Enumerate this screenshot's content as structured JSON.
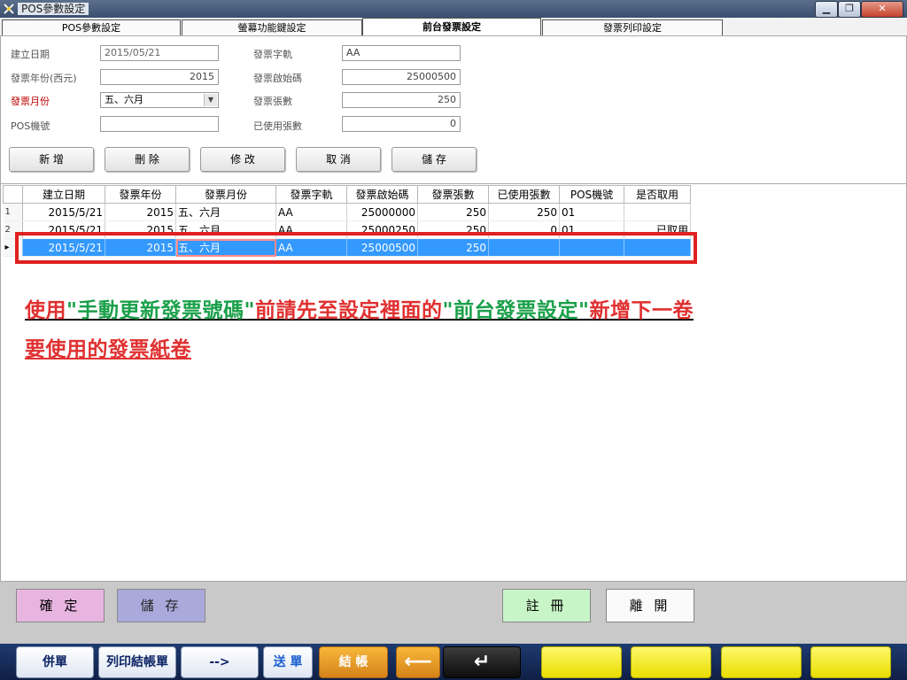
{
  "window": {
    "title": "POS參數設定",
    "controls": {
      "minimize": "▁",
      "restore": "❐",
      "close": "✕"
    }
  },
  "tabs": [
    {
      "label": "POS參數設定",
      "active": false
    },
    {
      "label": "螢幕功能鍵設定",
      "active": false
    },
    {
      "label": "前台發票設定",
      "active": true
    },
    {
      "label": "發票列印設定",
      "active": false
    }
  ],
  "form": {
    "created_date": {
      "label": "建立日期",
      "value": "2015/05/21"
    },
    "invoice_year": {
      "label": "發票年份(西元)",
      "value": "2015"
    },
    "invoice_month": {
      "label": "發票月份",
      "value": "五、六月"
    },
    "pos_number": {
      "label": "POS機號",
      "value": ""
    },
    "invoice_track": {
      "label": "發票字軌",
      "value": "AA"
    },
    "start_number": {
      "label": "發票啟始碼",
      "value": "25000500"
    },
    "invoice_count": {
      "label": "發票張數",
      "value": "250"
    },
    "used_count": {
      "label": "已使用張數",
      "value": "0"
    }
  },
  "actions": {
    "add": "新 增",
    "delete": "刪 除",
    "edit": "修 改",
    "cancel": "取 消",
    "save": "儲 存"
  },
  "grid": {
    "columns": [
      "建立日期",
      "發票年份",
      "發票月份",
      "發票字軌",
      "發票啟始碼",
      "發票張數",
      "已使用張數",
      "POS機號",
      "是否取用"
    ],
    "rows": [
      {
        "idx": "1",
        "date": "2015/5/21",
        "year": "2015",
        "month": "五、六月",
        "track": "AA",
        "start": "25000000",
        "count": "250",
        "used": "250",
        "pos": "01",
        "taken": ""
      },
      {
        "idx": "2",
        "date": "2015/5/21",
        "year": "2015",
        "month": "五、六月",
        "track": "AA",
        "start": "25000250",
        "count": "250",
        "used": "0",
        "pos": "01",
        "taken": "已取用"
      },
      {
        "idx": "▸",
        "date": "2015/5/21",
        "year": "2015",
        "month": "五、六月",
        "track": "AA",
        "start": "25000500",
        "count": "250",
        "used": "",
        "pos": "",
        "taken": ""
      }
    ]
  },
  "note": {
    "p1": "使用",
    "p2": "\"手動更新發票號碼\"",
    "p3": "前請先至設定裡面的",
    "p4": "\"前台發票設定\"",
    "p5": "新增下一卷",
    "line2": "要使用的發票紙卷"
  },
  "bottom": {
    "confirm": "確 定",
    "save": "儲 存",
    "register": "註 冊",
    "leave": "離 開"
  },
  "taskbar": {
    "merge": "併單",
    "print_checkout": "列印結帳單",
    "next": "-->",
    "send_order": "送 單",
    "checkout": "結 帳",
    "back_arrow": "⟵",
    "enter_arrow": "↵"
  },
  "colors": {
    "accent_selected_row": "#3399ff",
    "annotation_red": "#e03030",
    "annotation_green": "#1aa04a",
    "confirm_bg": "#e8b4e0",
    "save_bg": "#a9a9dc",
    "register_bg": "#c8f5c8",
    "taskbar_yellow": "#f2e900"
  }
}
